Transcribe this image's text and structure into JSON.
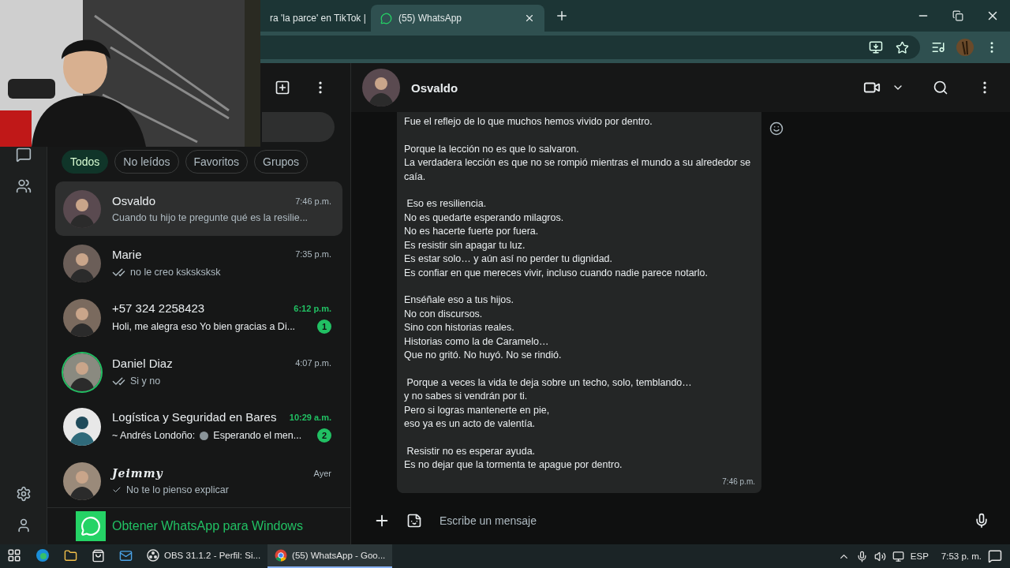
{
  "browser": {
    "tabs": [
      {
        "title": "ra 'la parce' en TikTok |",
        "selected": false,
        "kind": "page"
      },
      {
        "title": "(55) WhatsApp",
        "selected": true,
        "kind": "whatsapp"
      }
    ]
  },
  "filters": [
    {
      "label": "Todos",
      "selected": true
    },
    {
      "label": "No leídos",
      "selected": false
    },
    {
      "label": "Favoritos",
      "selected": false
    },
    {
      "label": "Grupos",
      "selected": false
    }
  ],
  "chats": [
    {
      "name": "Osvaldo",
      "time": "7:46 p.m.",
      "preview": "Cuando tu hijo te pregunte qué es la resilie...",
      "selected": true
    },
    {
      "name": "Marie",
      "time": "7:35 p.m.",
      "preview": "no le creo ksksksksk",
      "selected": false,
      "ticks_shown": true,
      "double_tick": true
    },
    {
      "name": "+57 324 2258423",
      "time": "6:12 p.m.",
      "preview": "Holi, me alegra eso  Yo bien gracias a Di...",
      "selected": false,
      "unread": "1"
    },
    {
      "name": "Daniel Diaz",
      "time": "4:07 p.m.",
      "preview": "Si y no",
      "selected": false,
      "ticks_shown": true,
      "double_tick": true,
      "status_ring": true
    },
    {
      "name": "Logística y Seguridad en Bares",
      "time": "10:29 a.m.",
      "preview_sender": "~ Andrés Londoño:",
      "preview": "Esperando el men...",
      "selected": false,
      "unread": "2",
      "voice_icon": true
    },
    {
      "name": "Jeimmy",
      "time": "Ayer",
      "preview": "No te lo pienso explicar",
      "selected": false,
      "ticks_shown": true,
      "double_tick": false,
      "fancy_name": true
    }
  ],
  "get_app": "Obtener WhatsApp para Windows",
  "conversation": {
    "contact": "Osvaldo",
    "message": {
      "paragraphs": [
        [
          "Fue el reflejo de lo que muchos hemos vivido por dentro."
        ],
        [
          "Porque la lección no es que lo salvaron.",
          "La verdadera lección es que no se rompió mientras el mundo a su alrededor se caía."
        ],
        [
          " Eso es resiliencia.",
          "No es quedarte esperando milagros.",
          "No es hacerte fuerte por fuera.",
          "Es resistir sin apagar tu luz.",
          "Es estar solo… y aún así no perder tu dignidad.",
          "Es confiar en que mereces vivir, incluso cuando nadie parece notarlo."
        ],
        [
          "Enséñale eso a tus hijos.",
          "No con discursos.",
          "Sino con historias reales.",
          "Historias como la de Caramelo…",
          "Que no gritó. No huyó. No se rindió."
        ],
        [
          " Porque a veces la vida te deja sobre un techo, solo, temblando…",
          "y no sabes si vendrán por ti.",
          "Pero si logras mantenerte en pie,",
          "eso ya es un acto de valentía."
        ],
        [
          " Resistir no es esperar ayuda.",
          "Es no dejar que la tormenta te apague por dentro."
        ]
      ],
      "time": "7:46 p.m."
    },
    "composer": {
      "placeholder": "Escribe un mensaje"
    }
  },
  "taskbar": {
    "apps": [
      {
        "label": "OBS 31.1.2 - Perfil: Si...",
        "kind": "obs",
        "selected": false
      },
      {
        "label": "(55) WhatsApp - Goo...",
        "kind": "chrome",
        "selected": true
      }
    ],
    "language": "ESP",
    "clock": "7:53 p. m."
  }
}
